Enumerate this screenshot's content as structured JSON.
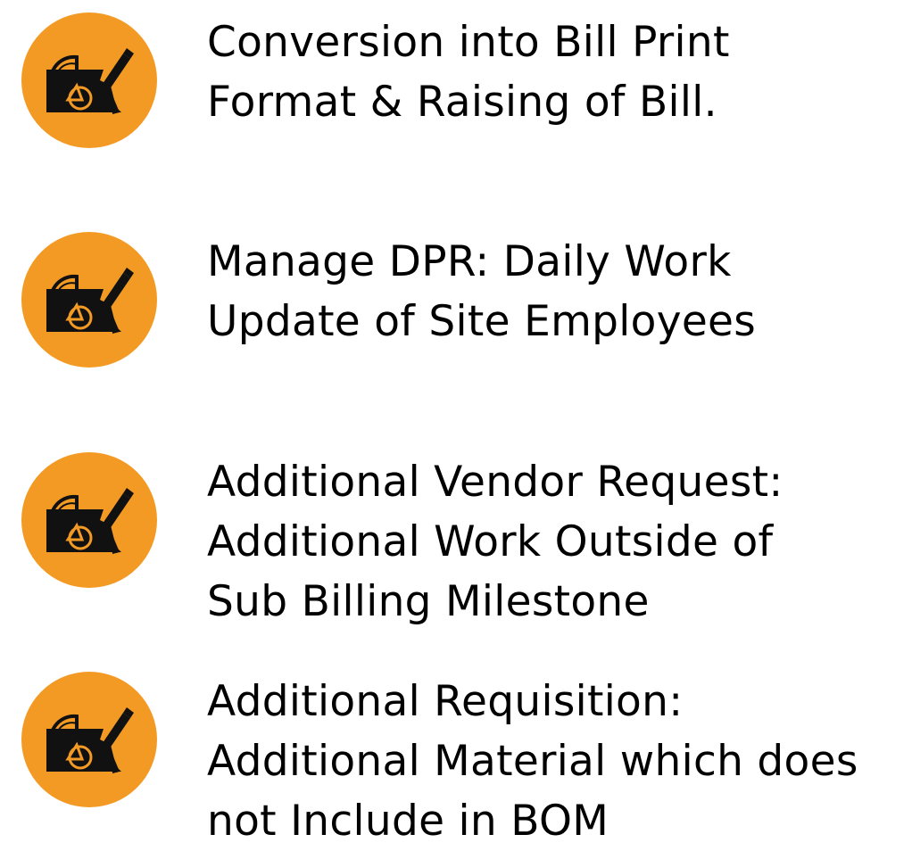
{
  "accent_color": "#F39A24",
  "icon": "drafting-compass-paper-pencil-icon",
  "features": [
    {
      "lines": [
        "Conversion into Bill Print",
        "Format & Raising of Bill."
      ]
    },
    {
      "lines": [
        "Manage DPR: Daily Work",
        "Update of Site Employees"
      ]
    },
    {
      "lines": [
        "Additional Vendor Request:",
        "Additional Work Outside of",
        "Sub Billing Milestone"
      ]
    },
    {
      "lines": [
        "Additional Requisition:",
        "Additional Material which does",
        "not Include in BOM"
      ]
    }
  ]
}
